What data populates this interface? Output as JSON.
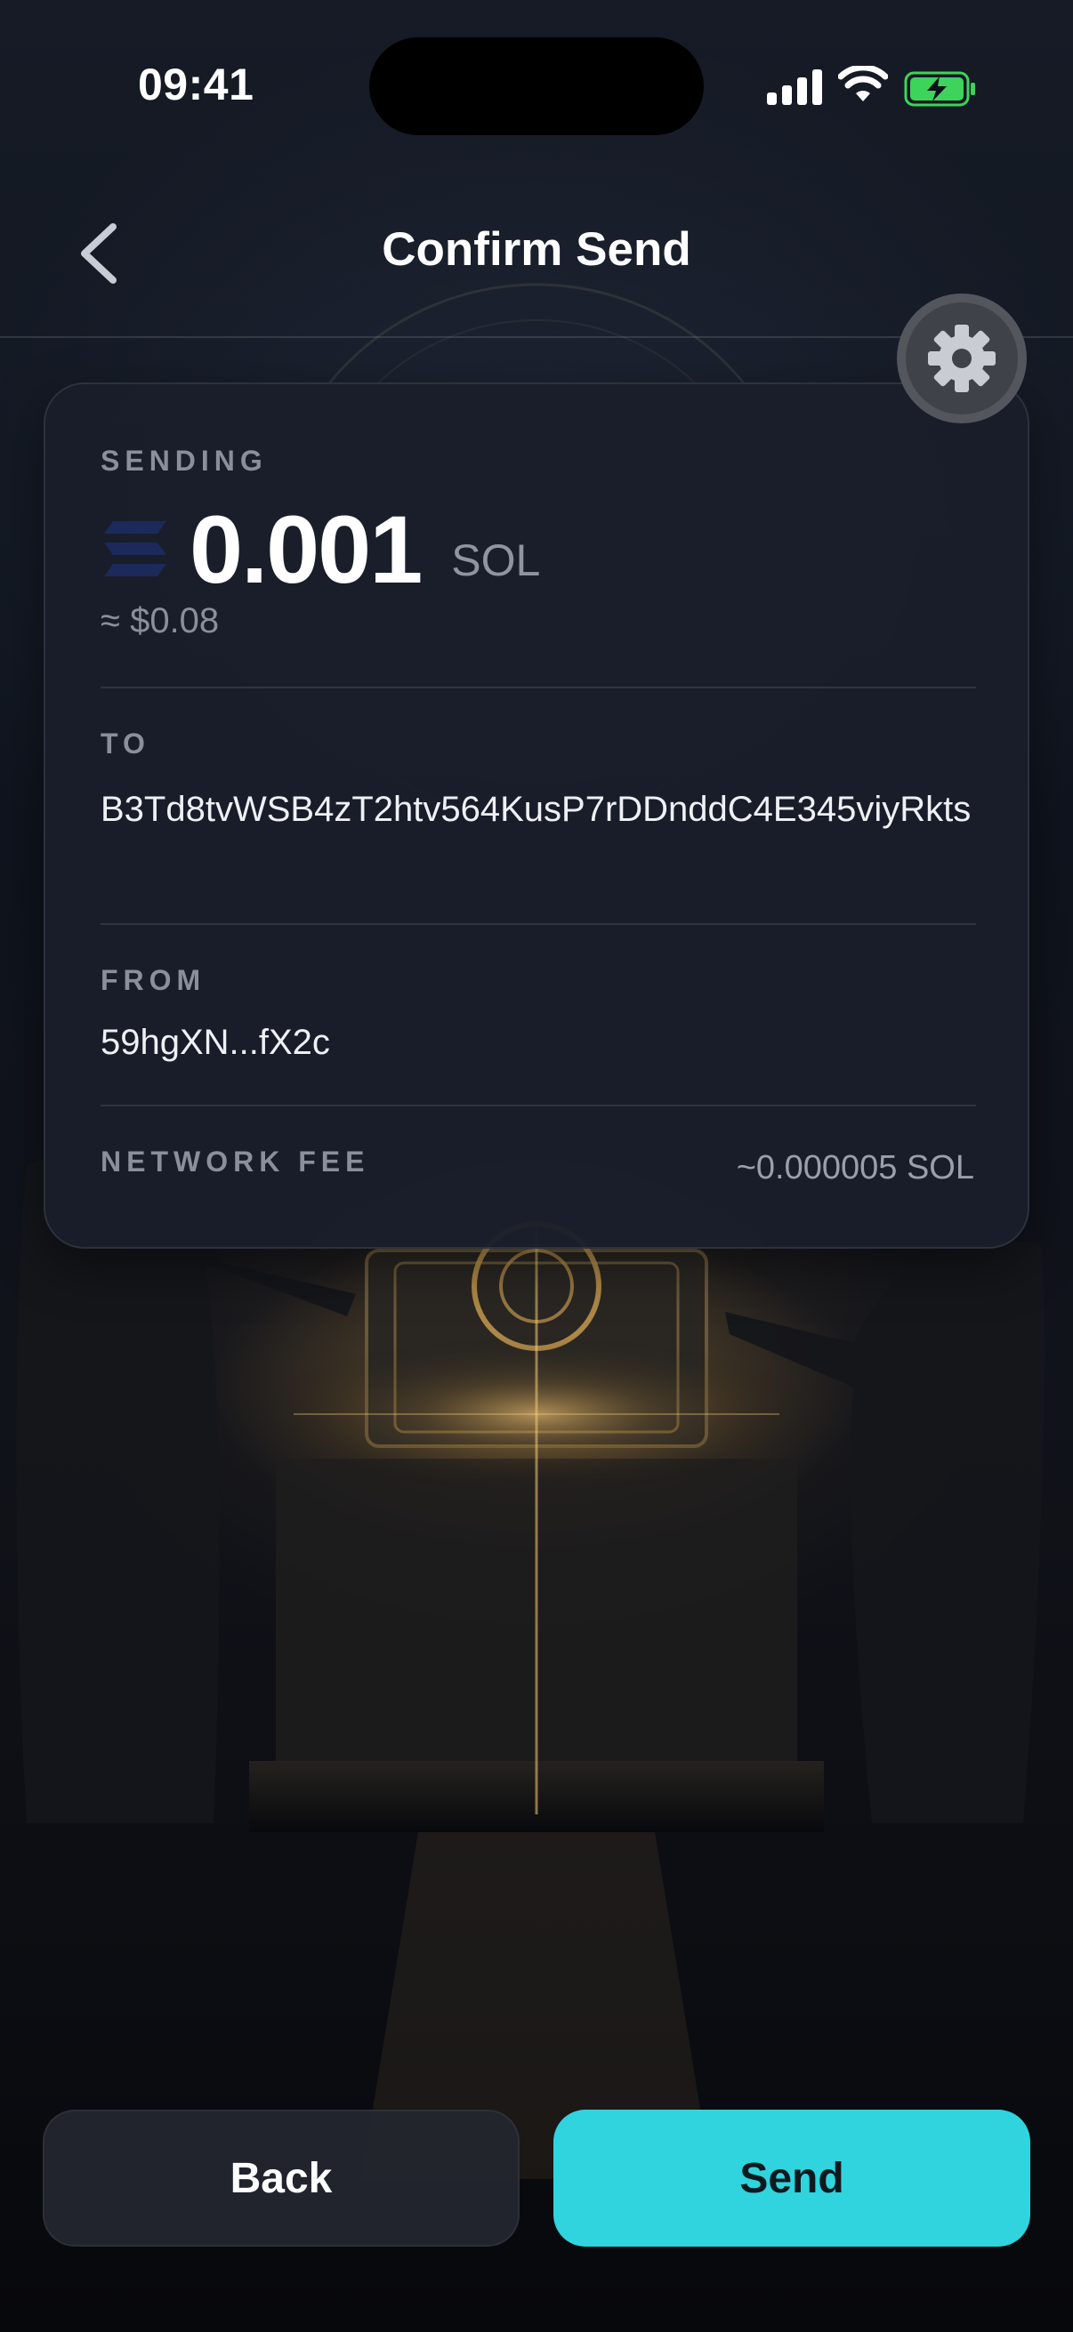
{
  "status_bar": {
    "time": "09:41",
    "icons": [
      "signal-icon",
      "wifi-icon",
      "battery-charging-icon"
    ],
    "battery_color": "#3ed35a"
  },
  "header": {
    "title": "Confirm Send",
    "back_icon": "chevron-left-icon",
    "settings_icon": "gear-icon"
  },
  "card": {
    "sending_label": "SENDING",
    "amount": "0.001",
    "unit": "SOL",
    "fiat": "≈ $0.08",
    "token_icon": "solana-icon",
    "to_label": "TO",
    "to_address": "B3Td8tvWSB4zT2htv564KusP7rDDnddC4E345viyRkts",
    "from_label": "FROM",
    "from_address": "59hgXN...fX2c",
    "fee_label": "NETWORK FEE",
    "fee_value": "~0.000005 SOL"
  },
  "actions": {
    "back_label": "Back",
    "send_label": "Send",
    "send_color": "#2fd4de"
  }
}
